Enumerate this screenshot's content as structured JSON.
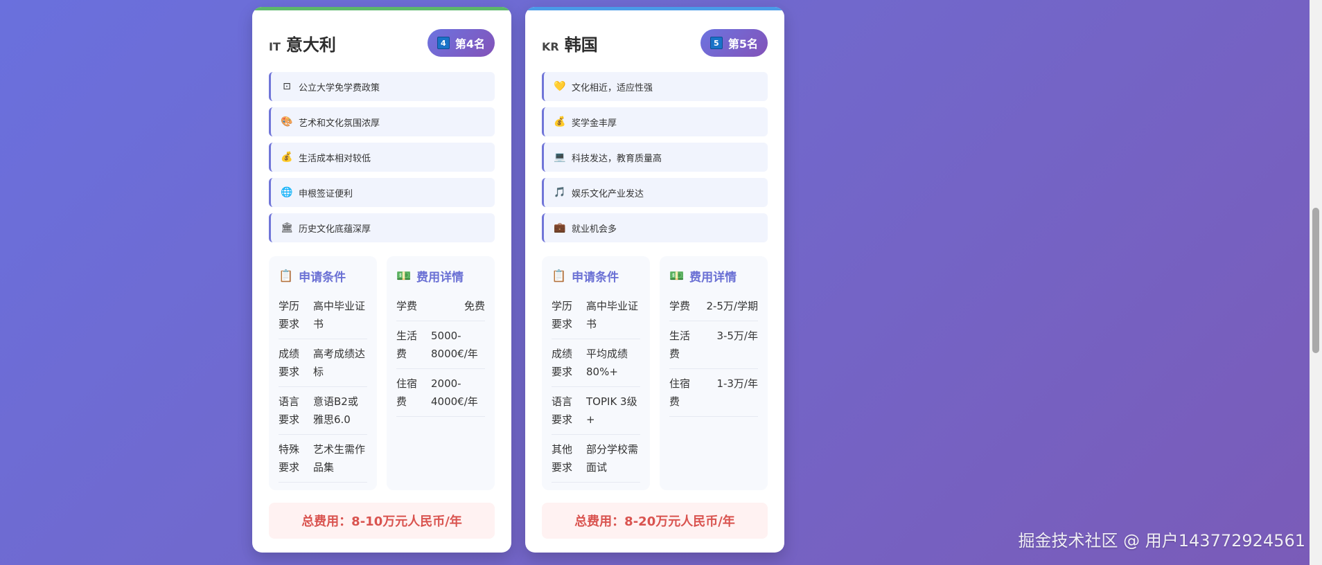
{
  "cards": [
    {
      "flag_code": "IT",
      "name": "意大利",
      "rank_num": "4",
      "rank_label": "第4名",
      "accent": "#5cb86a",
      "features": [
        {
          "icon": "⊡",
          "text": "公立大学免学费政策"
        },
        {
          "icon": "🎨",
          "text": "艺术和文化氛围浓厚"
        },
        {
          "icon": "💰",
          "text": "生活成本相对较低"
        },
        {
          "icon": "🌐",
          "text": "申根签证便利"
        },
        {
          "icon": "🏛",
          "text": "历史文化底蕴深厚"
        }
      ],
      "requirements": {
        "title": "申请条件",
        "rows": [
          {
            "k": "学历要求",
            "v": "高中毕业证书"
          },
          {
            "k": "成绩要求",
            "v": "高考成绩达标"
          },
          {
            "k": "语言要求",
            "v": "意语B2或雅思6.0"
          },
          {
            "k": "特殊要求",
            "v": "艺术生需作品集"
          }
        ]
      },
      "costs": {
        "title": "费用详情",
        "rows": [
          {
            "k": "学费",
            "v": "免费"
          },
          {
            "k": "生活费",
            "v": "5000-8000€/年"
          },
          {
            "k": "住宿费",
            "v": "2000-4000€/年"
          }
        ]
      },
      "total": "总费用：8-10万元人民币/年"
    },
    {
      "flag_code": "KR",
      "name": "韩国",
      "rank_num": "5",
      "rank_label": "第5名",
      "accent": "#4a9be8",
      "features": [
        {
          "icon": "💛",
          "text": "文化相近，适应性强"
        },
        {
          "icon": "💰",
          "text": "奖学金丰厚"
        },
        {
          "icon": "💻",
          "text": "科技发达，教育质量高"
        },
        {
          "icon": "🎵",
          "text": "娱乐文化产业发达"
        },
        {
          "icon": "💼",
          "text": "就业机会多"
        }
      ],
      "requirements": {
        "title": "申请条件",
        "rows": [
          {
            "k": "学历要求",
            "v": "高中毕业证书"
          },
          {
            "k": "成绩要求",
            "v": "平均成绩80%+"
          },
          {
            "k": "语言要求",
            "v": "TOPIK 3级+"
          },
          {
            "k": "其他要求",
            "v": "部分学校需面试"
          }
        ]
      },
      "costs": {
        "title": "费用详情",
        "rows": [
          {
            "k": "学费",
            "v": "2-5万/学期"
          },
          {
            "k": "生活费",
            "v": "3-5万/年"
          },
          {
            "k": "住宿费",
            "v": "1-3万/年"
          }
        ]
      },
      "total": "总费用：8-20万元人民币/年"
    }
  ],
  "watermark": "掘金技术社区 @ 用户143772924561"
}
